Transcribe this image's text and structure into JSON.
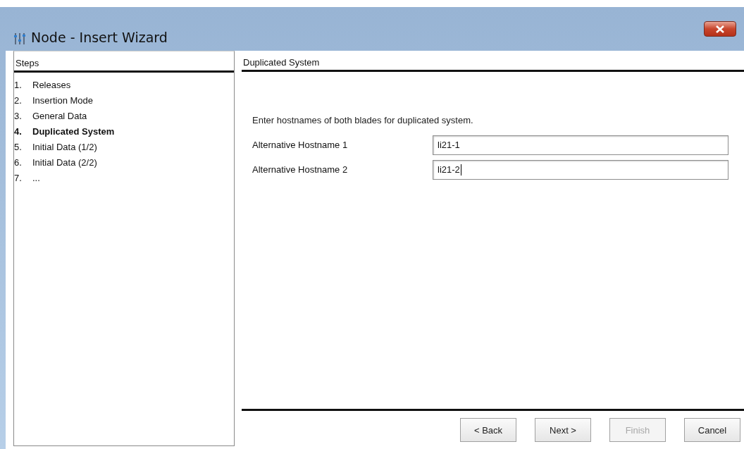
{
  "window": {
    "title": "Node - Insert Wizard"
  },
  "steps": {
    "heading": "Steps",
    "items": [
      {
        "number": "1.",
        "label": "Releases",
        "selected": false
      },
      {
        "number": "2.",
        "label": "Insertion Mode",
        "selected": false
      },
      {
        "number": "3.",
        "label": "General Data",
        "selected": false
      },
      {
        "number": "4.",
        "label": "Duplicated System",
        "selected": true
      },
      {
        "number": "5.",
        "label": "Initial Data (1/2)",
        "selected": false
      },
      {
        "number": "6.",
        "label": "Initial Data (2/2)",
        "selected": false
      },
      {
        "number": "7.",
        "label": "...",
        "selected": false
      }
    ]
  },
  "page": {
    "heading": "Duplicated System",
    "instruction": "Enter hostnames of both blades for duplicated system.",
    "fields": [
      {
        "label": "Alternative Hostname 1",
        "value": "li21-1",
        "focused": false
      },
      {
        "label": "Alternative Hostname 2",
        "value": "li21-2",
        "focused": true
      }
    ]
  },
  "buttons": [
    {
      "label": "< Back",
      "disabled": false
    },
    {
      "label": "Next >",
      "disabled": false
    },
    {
      "label": "Finish",
      "disabled": true
    },
    {
      "label": "Cancel",
      "disabled": false
    }
  ]
}
